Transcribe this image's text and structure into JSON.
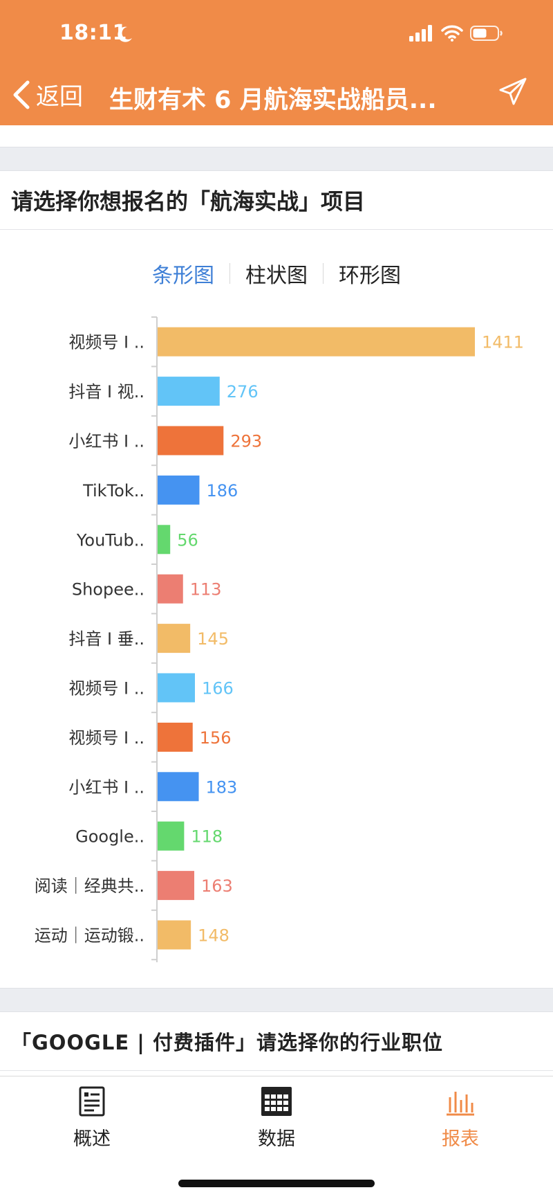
{
  "status_bar": {
    "time": "18:11"
  },
  "nav": {
    "back_label": "返回",
    "title": "生财有术 6 月航海实战船员..."
  },
  "section1": {
    "title": "请选择你想报名的「航海实战」项目",
    "tabs": [
      {
        "label": "条形图",
        "active": true
      },
      {
        "label": "柱状图",
        "active": false
      },
      {
        "label": "环形图",
        "active": false
      }
    ]
  },
  "chart_data": {
    "type": "bar",
    "orientation": "horizontal",
    "categories": [
      "视频号 I ..",
      "抖音 I 视..",
      "小红书 I ..",
      "TikTok..",
      "YouTub..",
      "Shopee..",
      "抖音 I 垂..",
      "视频号 I ..",
      "视频号 I ..",
      "小红书 I ..",
      "Google..",
      "阅读｜经典共..",
      "运动｜运动锻.."
    ],
    "values": [
      1411,
      276,
      293,
      186,
      56,
      113,
      145,
      166,
      156,
      183,
      118,
      163,
      148
    ],
    "colors": [
      "#f2bb67",
      "#62c4f7",
      "#ee733a",
      "#4593f1",
      "#64d86e",
      "#ec7e72",
      "#f2bb67",
      "#62c4f7",
      "#ee733a",
      "#4593f1",
      "#64d86e",
      "#ec7e72",
      "#f2bb67"
    ],
    "xlim": [
      0,
      1411
    ],
    "grid": false
  },
  "section2": {
    "title": "「GOOGLE | 付费插件」请选择你的行业职位"
  },
  "tabbar": {
    "items": [
      {
        "label": "概述",
        "icon": "document-icon",
        "active": false
      },
      {
        "label": "数据",
        "icon": "grid-icon",
        "active": false
      },
      {
        "label": "报表",
        "icon": "bar-chart-icon",
        "active": true
      }
    ],
    "accent": "#f08b48"
  }
}
